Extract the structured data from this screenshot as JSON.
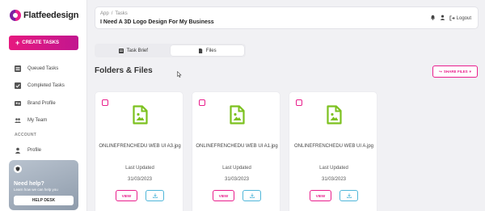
{
  "brand": {
    "logo_text": "Flatfeedesign",
    "accent": "#e6197f",
    "icon_green": "#7cc11f"
  },
  "sidebar": {
    "create_label": "CREATE TASKS",
    "items": [
      {
        "label": "Queued Tasks",
        "icon": "list-icon"
      },
      {
        "label": "Completed Tasks",
        "icon": "checkbox-icon"
      },
      {
        "label": "Brand Profile",
        "icon": "id-card-icon"
      },
      {
        "label": "My Team",
        "icon": "team-icon"
      }
    ],
    "account_label": "ACCOUNT",
    "profile_label": "Profile",
    "help": {
      "title": "Need help?",
      "subtitle": "Learn how we can help you",
      "button": "HELP DESK"
    }
  },
  "header": {
    "breadcrumb": [
      "App",
      "Tasks"
    ],
    "title": "I Need A 3D Logo Design For My Business",
    "logout_label": "Logout"
  },
  "tabs": [
    {
      "label": "Task Brief"
    },
    {
      "label": "Files"
    }
  ],
  "main": {
    "section_title": "Folders & Files",
    "share_label": "SHARE FILES"
  },
  "files": [
    {
      "name": "ONLINEFRENCHEDU WEB UI A3.jpg",
      "updated_label": "Last Updated",
      "date": "31/03/2023",
      "view_label": "VIEW"
    },
    {
      "name": "ONLINEFRENCHEDU WEB UI A1.jpg",
      "updated_label": "Last Updated",
      "date": "31/03/2023",
      "view_label": "VIEW"
    },
    {
      "name": "ONLINEFRENCHEDU WEB UI A.jpg",
      "updated_label": "Last Updated",
      "date": "31/03/2023",
      "view_label": "VIEW"
    }
  ]
}
